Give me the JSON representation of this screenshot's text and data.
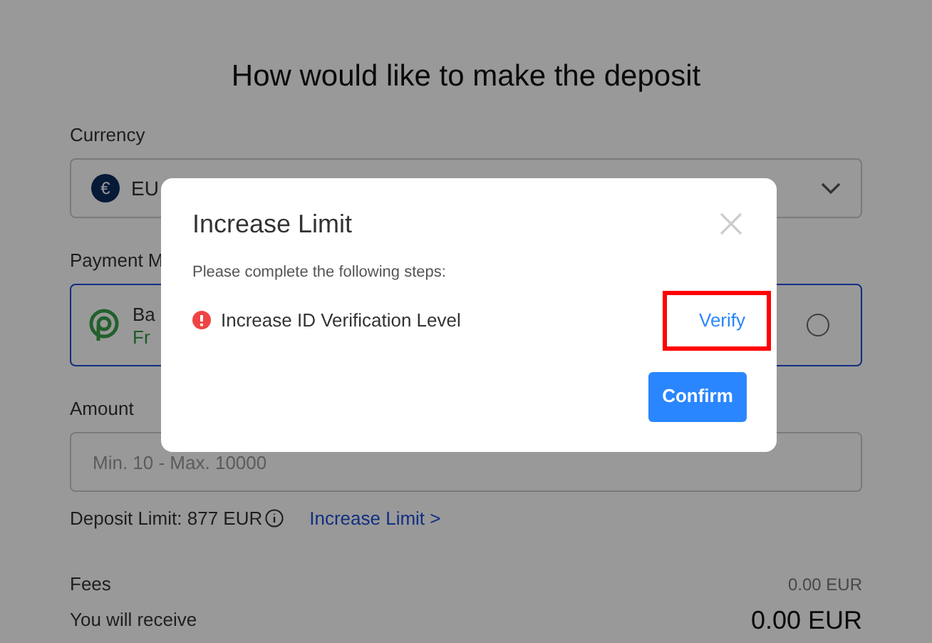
{
  "page": {
    "title": "How would like to make the deposit",
    "currency": {
      "label": "Currency",
      "symbol": "€",
      "value": "EU"
    },
    "payment_method": {
      "label": "Payment M",
      "name": "Ba",
      "note": "Fr",
      "checked": false
    },
    "amount": {
      "label": "Amount",
      "placeholder": "Min. 10 - Max. 10000"
    },
    "deposit_limit": "Deposit Limit: 877 EUR",
    "increase_link": "Increase Limit >",
    "summary": [
      {
        "label": "Fees",
        "value": "0.00 EUR",
        "kind": "minor"
      },
      {
        "label": "You will receive",
        "value": "0.00 EUR",
        "kind": "total"
      }
    ]
  },
  "dialog": {
    "title": "Increase Limit",
    "instructions": "Please complete the following steps:",
    "steps": [
      {
        "label": "Increase ID Verification Level",
        "done": false,
        "action": "Verify",
        "highlighted": true
      }
    ],
    "button": "Confirm"
  }
}
